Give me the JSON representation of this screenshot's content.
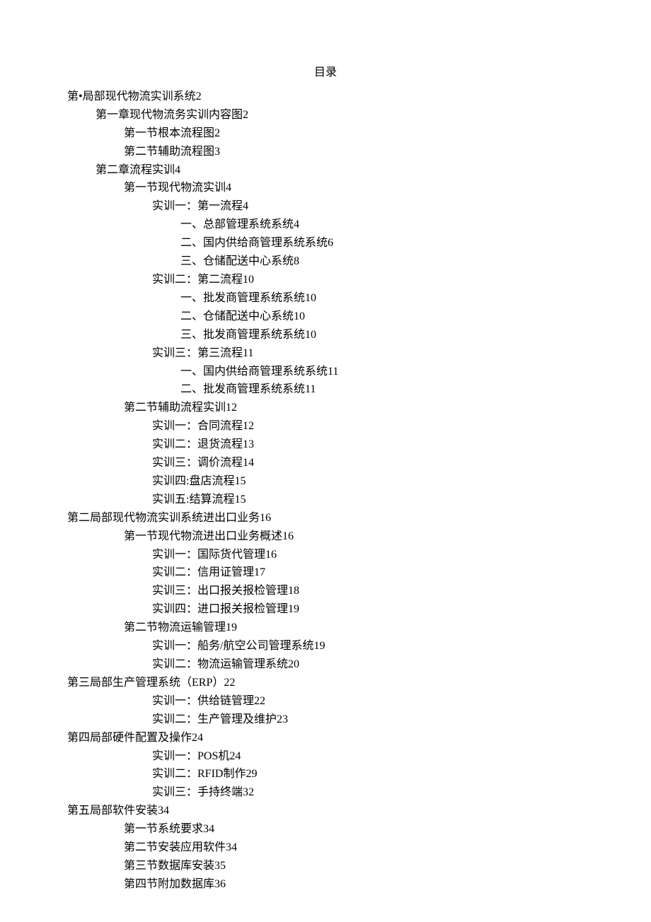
{
  "title": "目录",
  "toc": [
    {
      "indent": 0,
      "text": "第•局部现代物流实训系统2"
    },
    {
      "indent": 1,
      "text": "第一章现代物流务实训内容图2"
    },
    {
      "indent": 2,
      "text": "第一节根本流程图2"
    },
    {
      "indent": 2,
      "text": "第二节辅助流程图3"
    },
    {
      "indent": 1,
      "text": "第二章流程实训4"
    },
    {
      "indent": 2,
      "text": "第一节现代物流实训4"
    },
    {
      "indent": 3,
      "text": "实训一：第一流程4"
    },
    {
      "indent": 4,
      "text": "一、总部管理系统系统4"
    },
    {
      "indent": 4,
      "text": "二、国内供给商管理系统系统6"
    },
    {
      "indent": 4,
      "text": "三、仓储配送中心系统8"
    },
    {
      "indent": 3,
      "text": "实训二：第二流程10"
    },
    {
      "indent": 4,
      "text": "一、批发商管理系统系统10"
    },
    {
      "indent": 4,
      "text": "二、仓储配送中心系统10"
    },
    {
      "indent": 4,
      "text": "三、批发商管理系统系统10"
    },
    {
      "indent": 3,
      "text": "实训三：第三流程11"
    },
    {
      "indent": 4,
      "text": "一、国内供给商管理系统系统11"
    },
    {
      "indent": 4,
      "text": "二、批发商管理系统系统11"
    },
    {
      "indent": 2,
      "text": "第二节辅助流程实训12"
    },
    {
      "indent": 3,
      "text": "实训一：合同流程12"
    },
    {
      "indent": 3,
      "text": "实训二：退货流程13"
    },
    {
      "indent": 3,
      "text": "实训三：调价流程14"
    },
    {
      "indent": 3,
      "text": "实训四:盘店流程15"
    },
    {
      "indent": 3,
      "text": "实训五:结算流程15"
    },
    {
      "indent": 0,
      "text": "第二局部现代物流实训系统进出口业务16"
    },
    {
      "indent": 2,
      "text": "第一节现代物流进出口业务概述16"
    },
    {
      "indent": 3,
      "text": "实训一：国际货代管理16"
    },
    {
      "indent": 3,
      "text": "实训二：信用证管理17"
    },
    {
      "indent": 3,
      "text": "实训三：出口报关报检管理18"
    },
    {
      "indent": 3,
      "text": "实训四：进口报关报检管理19"
    },
    {
      "indent": 2,
      "text": "第二节物流运输管理19"
    },
    {
      "indent": 3,
      "text": "实训一：船务/航空公司管理系统19"
    },
    {
      "indent": 3,
      "text": "实训二：物流运输管理系统20"
    },
    {
      "indent": 0,
      "text": "第三局部生产管理系统（ERP）22"
    },
    {
      "indent": 3,
      "text": "实训一：供给链管理22"
    },
    {
      "indent": 3,
      "text": "实训二：生产管理及维护23"
    },
    {
      "indent": 0,
      "text": "第四局部硬件配置及操作24"
    },
    {
      "indent": 3,
      "text": "实训一：POS机24"
    },
    {
      "indent": 3,
      "text": "实训二：RFID制作29"
    },
    {
      "indent": 3,
      "text": "实训三：手持终端32"
    },
    {
      "indent": 0,
      "text": "第五局部软件安装34"
    },
    {
      "indent": 2,
      "text": "第一节系统要求34"
    },
    {
      "indent": 2,
      "text": "第二节安装应用软件34"
    },
    {
      "indent": 2,
      "text": "第三节数据库安装35"
    },
    {
      "indent": 2,
      "text": "第四节附加数据库36"
    }
  ]
}
